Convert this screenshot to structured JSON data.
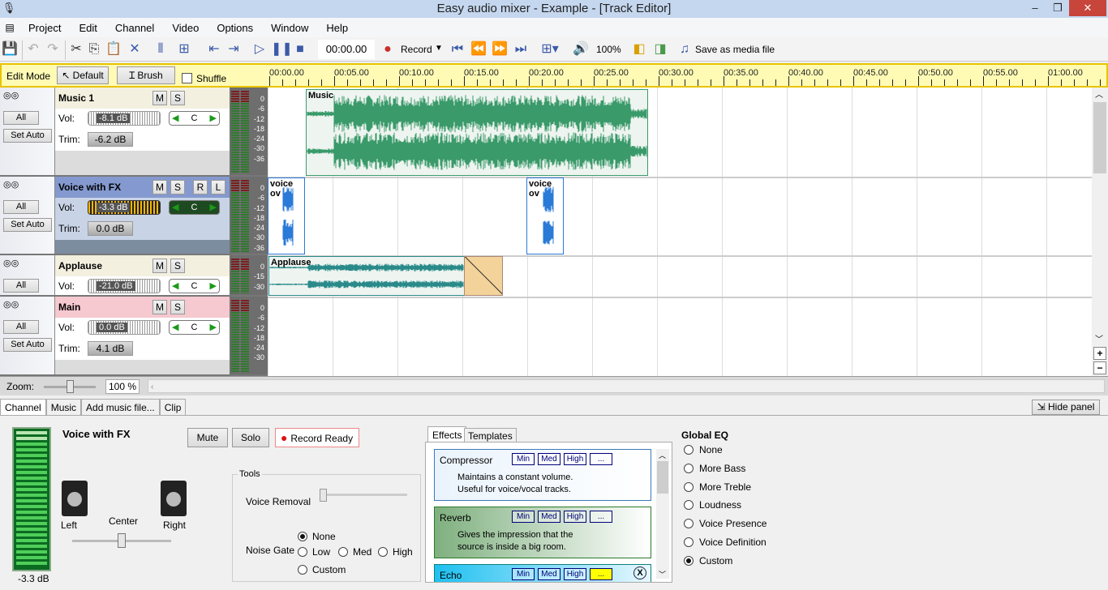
{
  "window": {
    "title": "Easy audio mixer - Example - [Track Editor]"
  },
  "menu": [
    "Project",
    "Edit",
    "Channel",
    "Video",
    "Options",
    "Window",
    "Help"
  ],
  "toolbar": {
    "time": "00:00.00",
    "record": "Record",
    "volume": "100%",
    "save": "Save as media file"
  },
  "editbar": {
    "label": "Edit Mode",
    "default": "Default",
    "brush": "Brush",
    "shuffle": "Shuffle"
  },
  "ruler": [
    "00:00.00",
    "00:05.00",
    "00:10.00",
    "00:15.00",
    "00:20.00",
    "00:25.00",
    "00:30.00",
    "00:35.00",
    "00:40.00",
    "00:45.00",
    "00:50.00",
    "00:55.00",
    "01:00.00"
  ],
  "common": {
    "all": "All",
    "set_auto": "Set Auto",
    "vol": "Vol:",
    "trim": "Trim:",
    "m": "M",
    "s": "S",
    "r": "R",
    "l": "L",
    "pan": "C"
  },
  "tracks": [
    {
      "name": "Music 1",
      "vol": "-8.1 dB",
      "trim": "-6.2 dB",
      "scale": [
        "0",
        "-6",
        "-12",
        "-18",
        "-24",
        "-30",
        "-36"
      ]
    },
    {
      "name": "Voice with FX",
      "vol": "-3.3 dB",
      "trim": "0.0 dB",
      "scale": [
        "0",
        "-6",
        "-12",
        "-18",
        "-24",
        "-30",
        "-36"
      ]
    },
    {
      "name": "Applause",
      "vol": "-21.0 dB",
      "scale": [
        "0",
        "-15",
        "-30"
      ]
    },
    {
      "name": "Main",
      "vol": "0.0 dB",
      "trim": "4.1 dB",
      "scale": [
        "0",
        "-6",
        "-12",
        "-18",
        "-24",
        "-30"
      ]
    }
  ],
  "clips": {
    "music": "Music",
    "voice1": "voice ov",
    "voice2": "voice ov",
    "applause": "Applause"
  },
  "zoom": {
    "label": "Zoom:",
    "value": "100 %",
    "level": 0.5
  },
  "tabs": [
    "Channel",
    "Music",
    "Add music file...",
    "Clip"
  ],
  "hide_panel": "Hide panel",
  "channel": {
    "name": "Voice with FX",
    "mute": "Mute",
    "solo": "Solo",
    "record_ready": "Record Ready",
    "left": "Left",
    "center": "Center",
    "right": "Right",
    "level": "-3.3 dB"
  },
  "tools": {
    "title": "Tools",
    "voice_removal": "Voice Removal",
    "noise_gate": "Noise Gate",
    "options": [
      "None",
      "Low",
      "Med",
      "High",
      "Custom"
    ],
    "selected": "None"
  },
  "effects": {
    "tabs": [
      "Effects",
      "Templates"
    ],
    "presets": [
      "Min",
      "Med",
      "High",
      "..."
    ],
    "items": [
      {
        "name": "Compressor",
        "desc1": "Maintains a constant volume.",
        "desc2": "Useful for voice/vocal tracks."
      },
      {
        "name": "Reverb",
        "desc1": "Gives the impression that the",
        "desc2": "source is inside a big room."
      },
      {
        "name": "Echo"
      }
    ]
  },
  "eq": {
    "title": "Global EQ",
    "options": [
      "None",
      "More Bass",
      "More Treble",
      "Loudness",
      "Voice Presence",
      "Voice Definition",
      "Custom"
    ],
    "selected": "Custom"
  },
  "colors": {
    "clip": "#3a9a6a",
    "voice": "#2a7ad8",
    "selected_track": "#8399cf",
    "main_track": "#f6c8cf",
    "editbar": "#fffbb4"
  }
}
